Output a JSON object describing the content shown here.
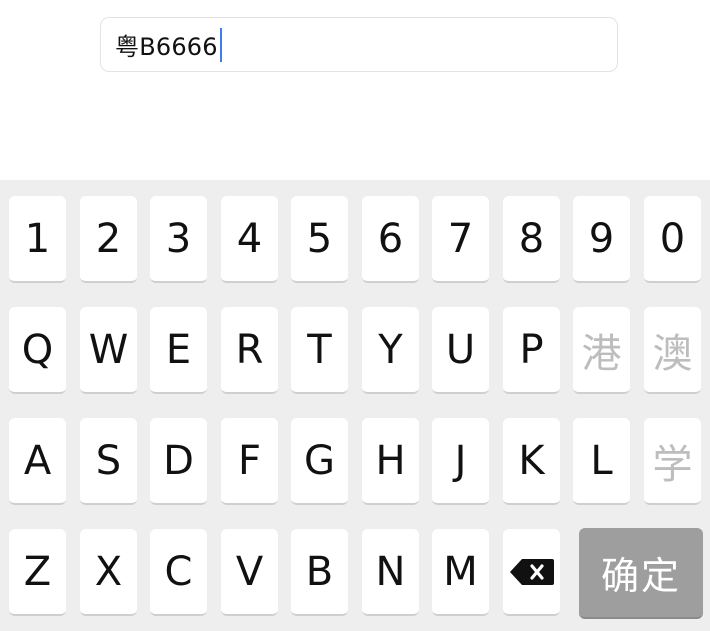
{
  "plate_input": {
    "value": "粤B6666"
  },
  "keyboard": {
    "row1": [
      "1",
      "2",
      "3",
      "4",
      "5",
      "6",
      "7",
      "8",
      "9",
      "0"
    ],
    "row2": [
      "Q",
      "W",
      "E",
      "R",
      "T",
      "Y",
      "U",
      "P",
      "港",
      "澳"
    ],
    "row3": [
      "A",
      "S",
      "D",
      "F",
      "G",
      "H",
      "J",
      "K",
      "L",
      "学"
    ],
    "row4": [
      "Z",
      "X",
      "C",
      "V",
      "B",
      "N",
      "M"
    ],
    "delete_icon": "backspace-icon",
    "confirm_label": "确定",
    "disabled_keys": [
      "港",
      "澳",
      "学"
    ],
    "colors": {
      "background": "#eeeeee",
      "key": "#ffffff",
      "disabled_text": "#bdbdbd",
      "confirm_bg": "#9e9e9e",
      "caret": "#3d7cf2"
    }
  }
}
